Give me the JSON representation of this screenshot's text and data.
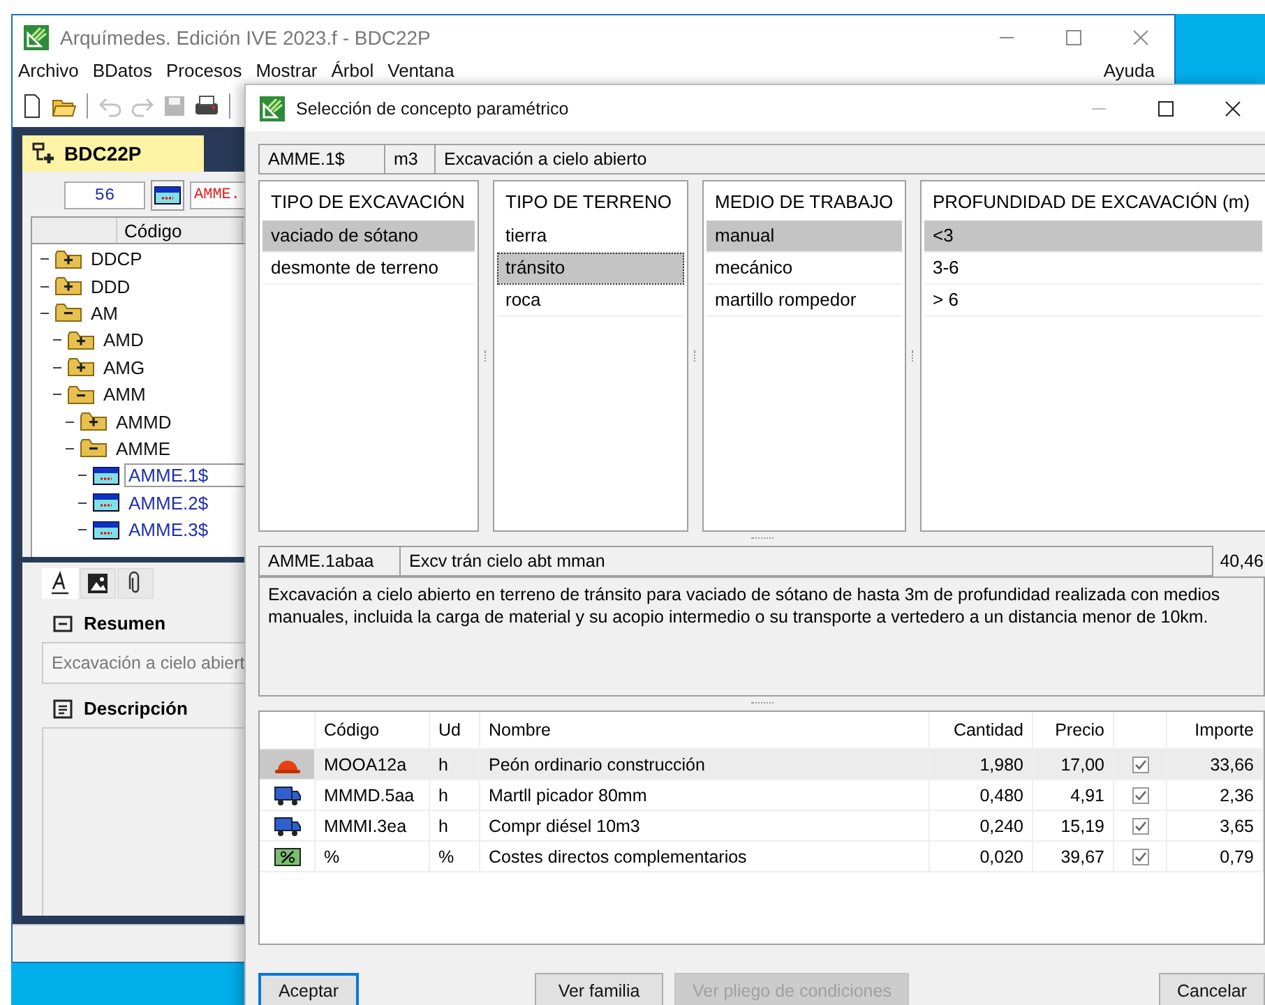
{
  "main_window": {
    "title": "Arquímedes. Edición IVE 2023.f - BDC22P",
    "menu": [
      "Archivo",
      "BDatos",
      "Procesos",
      "Mostrar",
      "Árbol",
      "Ventana"
    ],
    "help_menu": "Ayuda",
    "toolbar": [
      {
        "kind": "new",
        "disabled": false
      },
      {
        "kind": "open",
        "disabled": false
      },
      {
        "kind": "separator"
      },
      {
        "kind": "undo",
        "disabled": true
      },
      {
        "kind": "redo",
        "disabled": true
      },
      {
        "kind": "save",
        "disabled": true
      },
      {
        "kind": "print",
        "disabled": false
      },
      {
        "kind": "separator"
      }
    ],
    "document_tab": {
      "label": "BDC22P",
      "selected": true
    },
    "level_field": "56",
    "code_field": "AMME.",
    "tree_columns": [
      "Código"
    ],
    "tree": [
      {
        "label": "DDCP",
        "kind": "folder",
        "expanded": false,
        "selected": false
      },
      {
        "label": "DDD",
        "kind": "folder",
        "expanded": false,
        "selected": false
      },
      {
        "label": "AM",
        "kind": "folder",
        "expanded": true,
        "selected": false,
        "children": [
          {
            "label": "AMD",
            "kind": "folder",
            "expanded": false,
            "selected": false
          },
          {
            "label": "AMG",
            "kind": "folder",
            "expanded": false,
            "selected": false
          },
          {
            "label": "AMM",
            "kind": "folder",
            "expanded": true,
            "selected": false,
            "children": [
              {
                "label": "AMMD",
                "kind": "folder",
                "expanded": false,
                "selected": false
              },
              {
                "label": "AMME",
                "kind": "folder",
                "expanded": true,
                "selected": false,
                "children": [
                  {
                    "label": "AMME.1$",
                    "kind": "concept",
                    "selected": true
                  },
                  {
                    "label": "AMME.2$",
                    "kind": "concept",
                    "selected": false
                  },
                  {
                    "label": "AMME.3$",
                    "kind": "concept",
                    "selected": false
                  }
                ]
              }
            ]
          }
        ]
      }
    ],
    "panel_tabs": [
      {
        "kind": "text",
        "selected": true
      },
      {
        "kind": "image",
        "selected": false
      },
      {
        "kind": "attachment",
        "selected": false
      }
    ],
    "summary": {
      "label": "Resumen",
      "value": "Excavación a cielo abiert"
    },
    "description": {
      "label": "Descripción"
    }
  },
  "dialog": {
    "title": "Selección de concepto paramétrico",
    "concept": {
      "code": "AMME.1$",
      "unit": "m3",
      "summary": "Excavación a cielo abierto"
    },
    "parameters": [
      {
        "heading": "TIPO DE EXCAVACIÓN",
        "focused": false,
        "options": [
          {
            "label": "vaciado de sótano",
            "selected": true
          },
          {
            "label": "desmonte de terreno",
            "selected": false
          }
        ]
      },
      {
        "heading": "TIPO DE TERRENO",
        "focused": true,
        "options": [
          {
            "label": "tierra",
            "selected": false
          },
          {
            "label": "tránsito",
            "selected": true
          },
          {
            "label": "roca",
            "selected": false
          }
        ]
      },
      {
        "heading": "MEDIO DE TRABAJO",
        "focused": false,
        "options": [
          {
            "label": "manual",
            "selected": true
          },
          {
            "label": "mecánico",
            "selected": false
          },
          {
            "label": "martillo rompedor",
            "selected": false
          }
        ]
      },
      {
        "heading": "PROFUNDIDAD DE EXCAVACIÓN (m)",
        "focused": false,
        "options": [
          {
            "label": "<3",
            "selected": true
          },
          {
            "label": "3-6",
            "selected": false
          },
          {
            "label": "> 6",
            "selected": false
          }
        ]
      }
    ],
    "result": {
      "code": "AMME.1abaa",
      "summary": "Excv trán cielo abt mman",
      "price": "40,46",
      "text": "Excavación a cielo abierto en terreno de tránsito para vaciado de sótano de hasta 3m de profundidad realizada con medios manuales, incluida la carga de material y su acopio intermedio o su transporte a vertedero a un distancia menor de 10km."
    },
    "breakdown": {
      "columns": [
        "Código",
        "Ud",
        "Nombre",
        "Cantidad",
        "Precio",
        "Importe"
      ],
      "rows": [
        {
          "kind": "labor",
          "code": "MOOA12a",
          "unit": "h",
          "name": "Peón ordinario construcción",
          "quantity": "1,980",
          "price": "17,00",
          "checked": true,
          "amount": "33,66",
          "selected": true
        },
        {
          "kind": "machine",
          "code": "MMMD.5aa",
          "unit": "h",
          "name": "Martll picador 80mm",
          "quantity": "0,480",
          "price": "4,91",
          "checked": true,
          "amount": "2,36",
          "selected": false
        },
        {
          "kind": "machine",
          "code": "MMMI.3ea",
          "unit": "h",
          "name": "Compr diésel 10m3",
          "quantity": "0,240",
          "price": "15,19",
          "checked": true,
          "amount": "3,65",
          "selected": false
        },
        {
          "kind": "percent",
          "code": "%",
          "unit": "%",
          "name": "Costes directos complementarios",
          "quantity": "0,020",
          "price": "39,67",
          "checked": true,
          "amount": "0,79",
          "selected": false
        }
      ]
    },
    "buttons": [
      {
        "label": "Aceptar",
        "default": true,
        "disabled": false
      },
      {
        "label": "Ver familia",
        "default": false,
        "disabled": false
      },
      {
        "label": "Ver pliego de condiciones",
        "default": false,
        "disabled": true
      },
      {
        "label": "Cancelar",
        "default": false,
        "disabled": false
      }
    ]
  }
}
